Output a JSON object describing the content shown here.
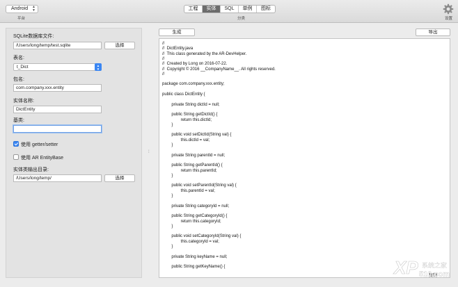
{
  "toolbar": {
    "platform_value": "Android",
    "platform_caption": "平台",
    "tabs": [
      {
        "label": "工程",
        "active": false
      },
      {
        "label": "实体",
        "active": true
      },
      {
        "label": "SQL",
        "active": false
      },
      {
        "label": "单例",
        "active": false
      },
      {
        "label": "图标",
        "active": false
      }
    ],
    "tabs_caption": "分类",
    "settings_caption": "设置"
  },
  "left": {
    "db_label": "SQLite数据库文件:",
    "db_value": "/Users/long/temp/test.sqlite",
    "db_choose": "选择",
    "table_label": "表名:",
    "table_value": "t_Dict",
    "package_label": "包名:",
    "package_value": "com.company.xxx.entity",
    "entity_label": "实体名称:",
    "entity_value": "DictEntity",
    "base_label": "基类:",
    "base_value": "",
    "getter_label": "使用 getter/setter",
    "getter_checked": true,
    "ar_label": "使用 AR EntityBase",
    "ar_checked": false,
    "output_label": "实体类输出目录:",
    "output_value": "/Users/long/temp/",
    "output_choose": "选择"
  },
  "right": {
    "generate": "生成",
    "export": "导出",
    "copy": "复制",
    "code_lines": [
      "//",
      "//  DictEntity.java",
      "//  This class generated by the AR-DevHelper.",
      "//",
      "//  Created by Long on 2016-07-22.",
      "//  Copyright © 2016 __CompanyName__. All rights reserved.",
      "//",
      "",
      "package com.company.xxx.entity;",
      "",
      "public class DictEntity {",
      "",
      "        private String dictId = null;",
      "",
      "        public String getDictId() {",
      "                return this.dictId;",
      "        }",
      "",
      "        public void setDictId(String val) {",
      "                this.dictId = val;",
      "        }",
      "",
      "        private String parentId = null;",
      "",
      "        public String getParentId() {",
      "                return this.parentId;",
      "        }",
      "",
      "        public void setParentId(String val) {",
      "                this.parentId = val;",
      "        }",
      "",
      "        private String categoryId = null;",
      "",
      "        public String getCategoryId() {",
      "                return this.categoryId;",
      "        }",
      "",
      "        public void setCategoryId(String val) {",
      "                this.categoryId = val;",
      "        }",
      "",
      "        private String keyName = null;",
      "",
      "        public String getKeyName() {"
    ]
  },
  "watermark": {
    "text_cn": "系统之家",
    "text_num": "510.com",
    "logo_letters": "XP"
  },
  "colors": {
    "accent": "#3a86f3",
    "active_tab": "#6c6c6c"
  }
}
